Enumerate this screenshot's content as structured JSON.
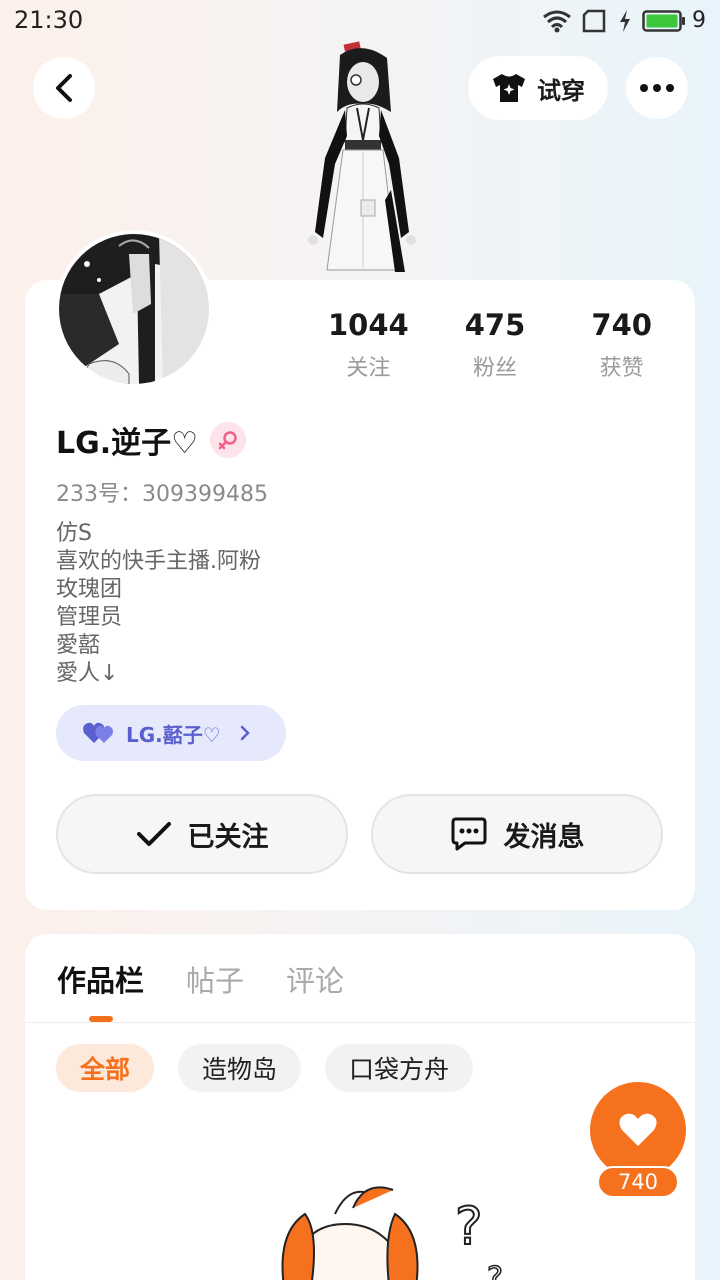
{
  "status_bar": {
    "time": "21:30",
    "battery_level": "9"
  },
  "header": {
    "try_on_label": "试穿"
  },
  "profile": {
    "stats": [
      {
        "value": "1044",
        "label": "关注"
      },
      {
        "value": "475",
        "label": "粉丝"
      },
      {
        "value": "740",
        "label": "获赞"
      }
    ],
    "username": "LG.逆子♡",
    "uid": "233号：309399485",
    "bio_lines": [
      "仿S",
      "喜欢的快手主播.阿粉",
      "玫瑰团",
      "管理员",
      "愛嚭",
      "愛人↓"
    ],
    "partner_name": "LG.嚭子♡",
    "follow_label": "已关注",
    "message_label": "发消息"
  },
  "works": {
    "tabs": [
      "作品栏",
      "帖子",
      "评论"
    ],
    "chips": [
      "全部",
      "造物岛",
      "口袋方舟"
    ]
  },
  "like": {
    "count": "740"
  },
  "colors": {
    "accent": "#f6711d",
    "partner_pill": "#e6e8fb",
    "partner_text": "#5a5fd0",
    "gender_badge": "#fde3ea"
  }
}
